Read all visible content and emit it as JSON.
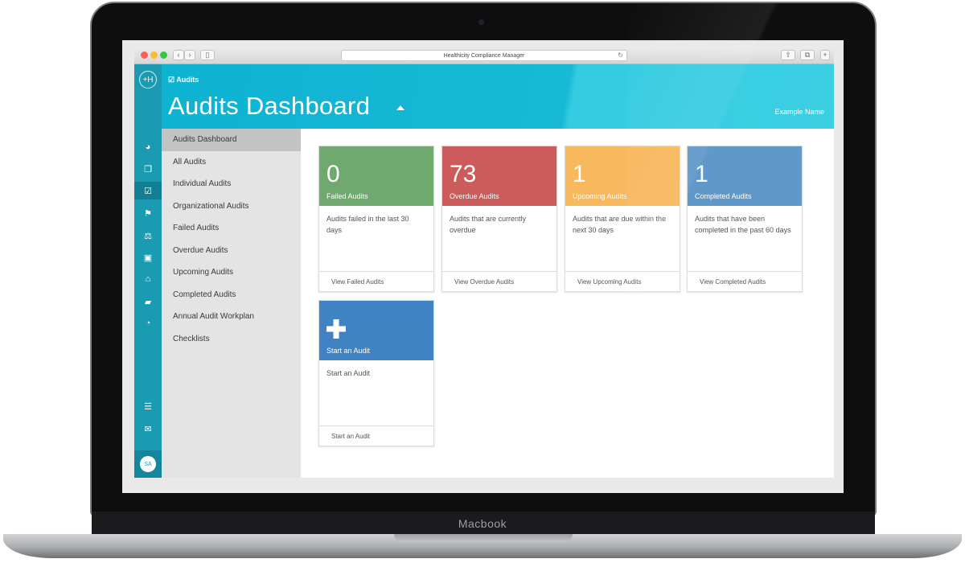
{
  "device": {
    "brand_label": "Macbook"
  },
  "browser": {
    "url_title": "Healthicity Compliance Manager",
    "back_icon": "chevron-left-icon",
    "forward_icon": "chevron-right-icon",
    "sidebar_icon": "sidebar-toggle-icon",
    "reload_icon": "reload-icon",
    "share_icon": "share-icon",
    "tabs_icon": "tabs-icon"
  },
  "app": {
    "logo_text": "+H",
    "header": {
      "breadcrumb": "☑ Audits",
      "title": "Audits Dashboard",
      "user_name": "Example Name"
    },
    "rail": {
      "items": [
        {
          "icon": "dashboard-gauge-icon",
          "glyph": "◕"
        },
        {
          "icon": "documents-icon",
          "glyph": "❐"
        },
        {
          "icon": "audits-check-icon",
          "glyph": "☑",
          "active": true
        },
        {
          "icon": "flag-icon",
          "glyph": "⚑"
        },
        {
          "icon": "balance-scale-icon",
          "glyph": "⚖"
        },
        {
          "icon": "briefcase-icon",
          "glyph": "▣"
        },
        {
          "icon": "institution-icon",
          "glyph": "⌂"
        },
        {
          "icon": "folder-open-icon",
          "glyph": "▰"
        },
        {
          "icon": "pie-chart-icon",
          "glyph": "◔"
        }
      ],
      "bottom_items": [
        {
          "icon": "list-ordered-icon",
          "glyph": "☰"
        },
        {
          "icon": "envelope-icon",
          "glyph": "✉"
        }
      ],
      "avatar_initials": "SA"
    },
    "subnav": [
      {
        "label": "Audits Dashboard",
        "active": true
      },
      {
        "label": "All Audits"
      },
      {
        "label": "Individual Audits"
      },
      {
        "label": "Organizational Audits"
      },
      {
        "label": "Failed Audits"
      },
      {
        "label": "Overdue Audits"
      },
      {
        "label": "Upcoming Audits"
      },
      {
        "label": "Completed Audits"
      },
      {
        "label": "Annual Audit Workplan"
      },
      {
        "label": "Checklists"
      }
    ],
    "cards": [
      {
        "value": "0",
        "label": "Failed Audits",
        "description": "Audits failed in the last 30 days",
        "link": "View Failed Audits",
        "color": "#6fa96f"
      },
      {
        "value": "73",
        "label": "Overdue Audits",
        "description": "Audits that are currently overdue",
        "link": "View Overdue Audits",
        "color": "#cc5b5b"
      },
      {
        "value": "1",
        "label": "Upcoming Audits",
        "description": "Audits that are due within the next 30 days",
        "link": "View Upcoming Audits",
        "color": "#f8b85e"
      },
      {
        "value": "1",
        "label": "Completed Audits",
        "description": "Audits that have been completed in the past 60 days",
        "link": "View Completed Audits",
        "color": "#5f98c9"
      },
      {
        "value": "",
        "icon": "plus-icon",
        "label": "Start an Audit",
        "description": "Start an Audit",
        "link": "Start an Audit",
        "color": "#3f83c4"
      }
    ]
  }
}
